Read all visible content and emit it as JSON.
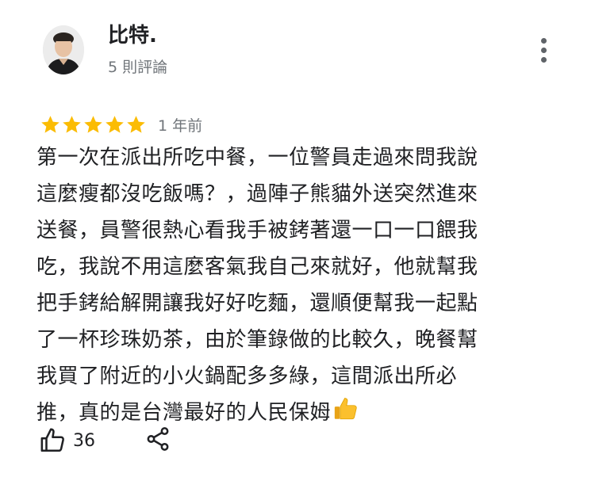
{
  "reviewer": {
    "name": "比特.",
    "review_count": "5 則評論"
  },
  "review": {
    "rating": 5,
    "max_rating": 5,
    "star_color": "#fbbc04",
    "time": "1 年前",
    "lines": [
      "第一次在派出所吃中餐，一位警員走過來問我說",
      "這麼瘦都沒吃飯嗎？，過陣子熊貓外送突然進來",
      "送餐，員警很熱心看我手被銬著還一口一口餵我",
      "吃，我說不用這麼客氣我自己來就好，他就幫我",
      "把手銬給解開讓我好好吃麵，還順便幫我一起點",
      "了一杯珍珠奶茶，由於筆錄做的比較久，晚餐幫",
      "我買了附近的小火鍋配多多綠，這間派出所必",
      "推，真的是台灣最好的人民保姆"
    ],
    "trailing_emoji": "thumbs-up-emoji"
  },
  "actions": {
    "like_icon": "thumbs-up-outline-icon",
    "like_count": "36",
    "share_icon": "share-icon",
    "more_icon": "more-vert-icon"
  }
}
